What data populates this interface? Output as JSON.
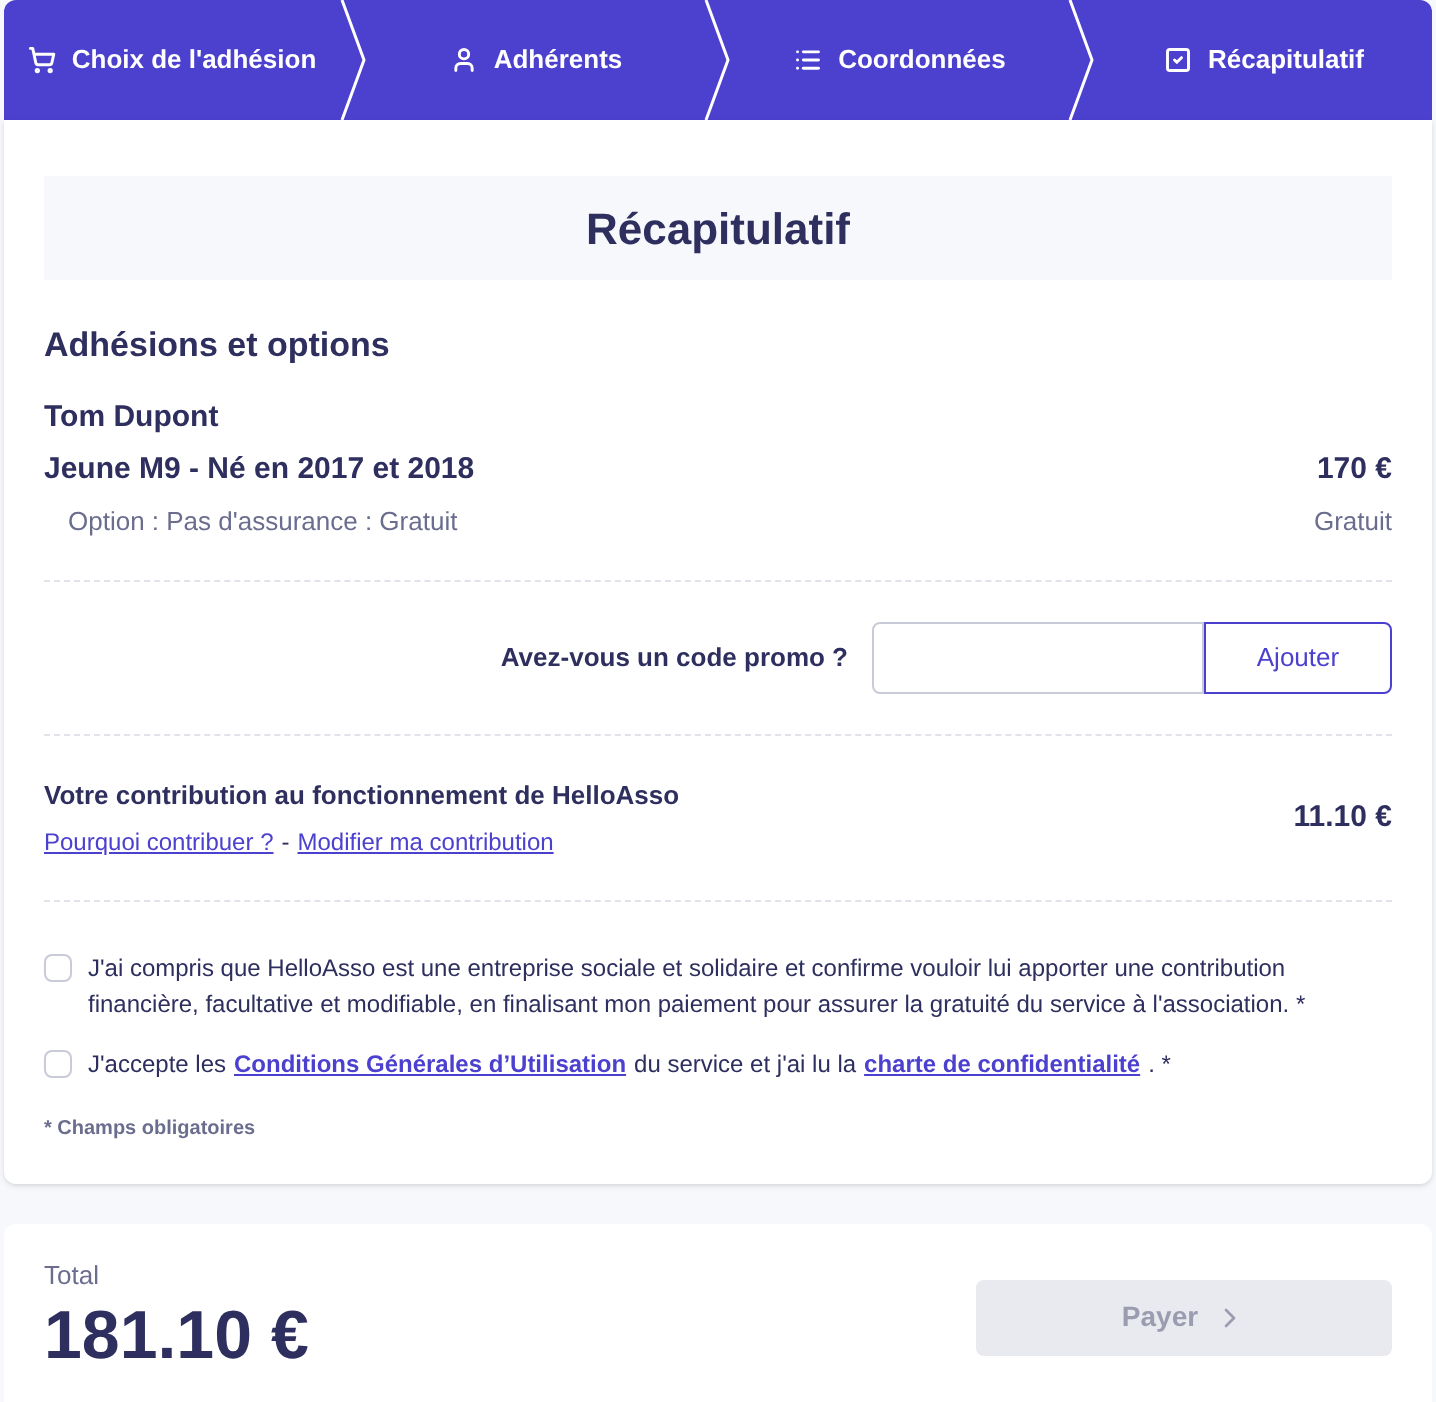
{
  "steps": [
    {
      "label": "Choix de l'adhésion"
    },
    {
      "label": "Adhérents"
    },
    {
      "label": "Coordonnées"
    },
    {
      "label": "Récapitulatif"
    }
  ],
  "title": "Récapitulatif",
  "section_title": "Adhésions et options",
  "member": {
    "name": "Tom Dupont",
    "tariff": "Jeune M9 - Né en 2017 et 2018",
    "price": "170 €",
    "option": "Option : Pas d'assurance : Gratuit",
    "option_price": "Gratuit"
  },
  "promo": {
    "label": "Avez-vous un code promo ?",
    "button": "Ajouter"
  },
  "contribution": {
    "title": "Votre contribution au fonctionnement de HelloAsso",
    "links": [
      "Pourquoi contribuer ?",
      "Modifier ma contribution"
    ],
    "separator": "-",
    "amount": "11.10 €"
  },
  "checkboxes": [
    {
      "checked": false,
      "parts": [
        {
          "kind": "text",
          "text": "J'ai compris que HelloAsso est une entreprise sociale et solidaire et confirme vouloir lui apporter une contribution financière, facultative et modifiable, en finalisant mon paiement pour assurer la gratuité du service à l'association. *"
        }
      ]
    },
    {
      "checked": false,
      "parts": [
        {
          "kind": "text",
          "text": "J'accepte les"
        },
        {
          "kind": "link",
          "text": "Conditions Générales d’Utilisation"
        },
        {
          "kind": "text",
          "text": "du service et j'ai lu la"
        },
        {
          "kind": "link",
          "text": "charte de confidentialité"
        },
        {
          "kind": "text",
          "text": ". *"
        }
      ]
    }
  ],
  "required_note": "* Champs obligatoires",
  "total": {
    "label": "Total",
    "amount": "181.10 €"
  },
  "pay_button": {
    "label": "Payer",
    "disabled": true
  }
}
